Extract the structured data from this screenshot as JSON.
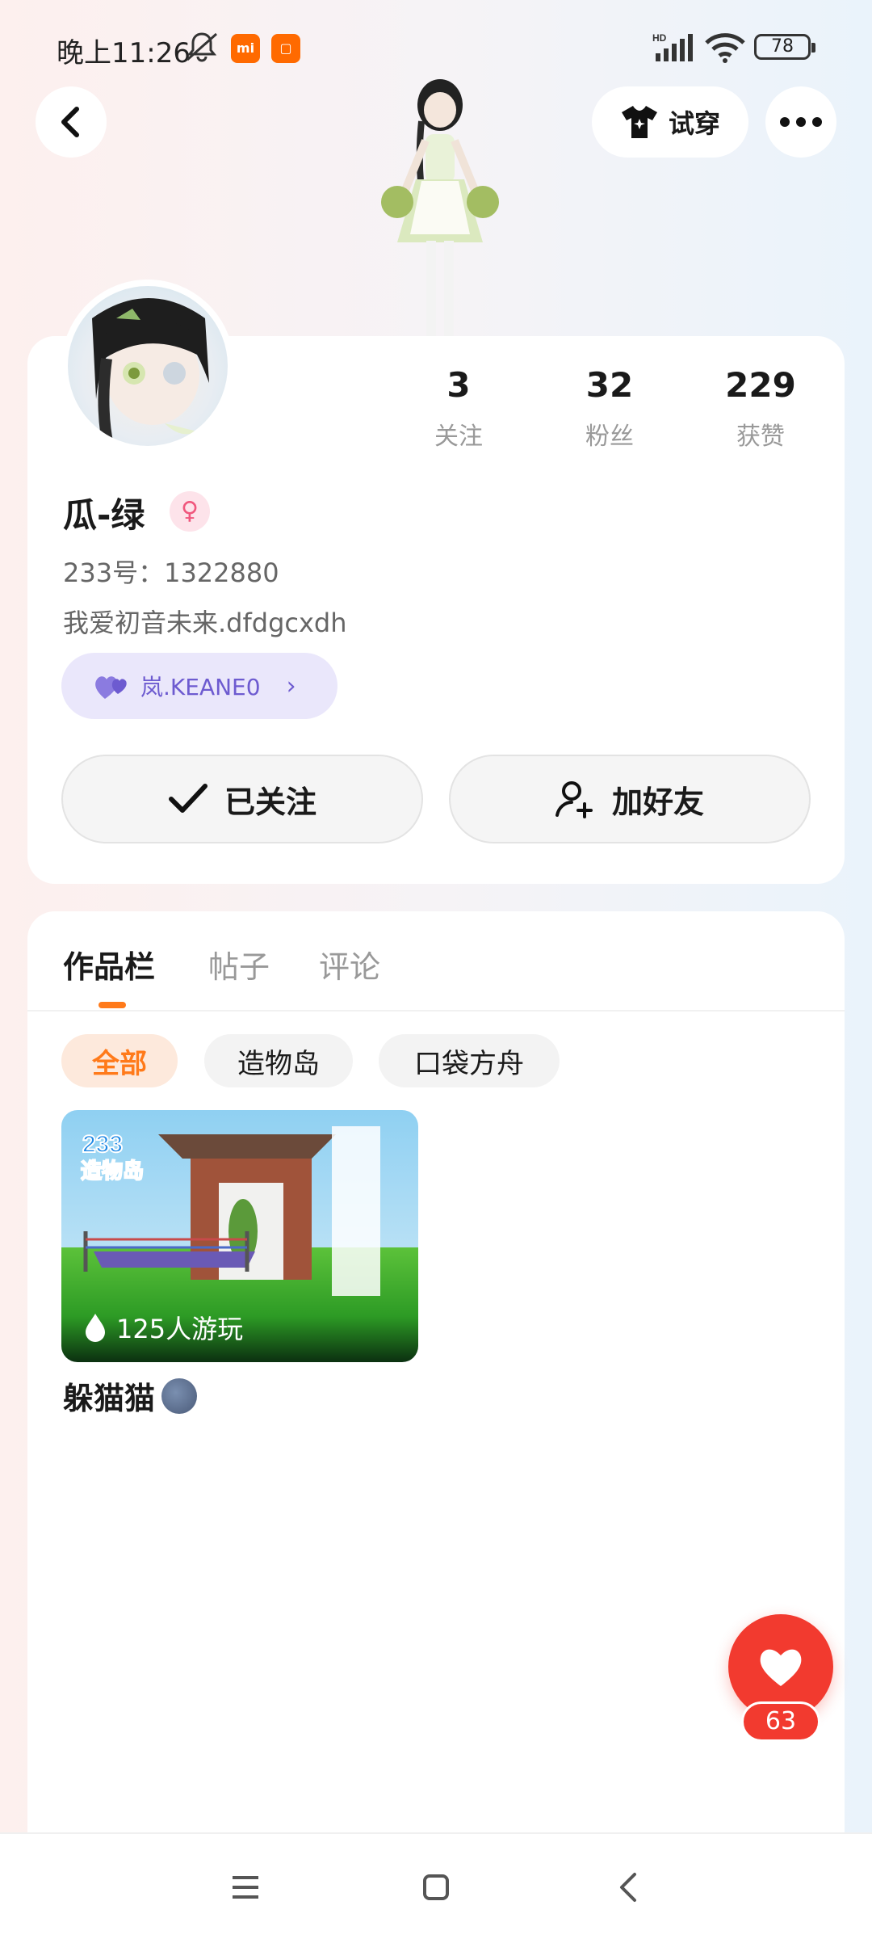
{
  "status_bar": {
    "time": "晚上11:26",
    "app_badges": [
      "mi",
      "mi"
    ],
    "network": "HD",
    "battery": "78"
  },
  "header": {
    "back_icon": "chevron-left-icon",
    "tryon_label": "试穿",
    "more_icon": "more-dots-icon"
  },
  "profile": {
    "stats": [
      {
        "value": "3",
        "label": "关注"
      },
      {
        "value": "32",
        "label": "粉丝"
      },
      {
        "value": "229",
        "label": "获赞"
      }
    ],
    "nickname": "瓜-绿",
    "gender_icon": "female-icon",
    "uid": "233号：1322880",
    "bio": "我爱初音未来.dfdgcxdh",
    "fan_tag": "岚.KEANE0",
    "follow_label": "已关注",
    "add_friend_label": "加好友"
  },
  "works": {
    "tabs": [
      "作品栏",
      "帖子",
      "评论"
    ],
    "filters": [
      "全部",
      "造物岛",
      "口袋方舟"
    ],
    "items": [
      {
        "title": "躲猫猫",
        "plays": "125人游玩",
        "logo_text": "233造物岛"
      }
    ]
  },
  "like_fab": {
    "count": "63"
  },
  "colors": {
    "accent": "#ff7a1a",
    "like": "#f23a2f",
    "tag_purple": "#6d5bd0"
  }
}
